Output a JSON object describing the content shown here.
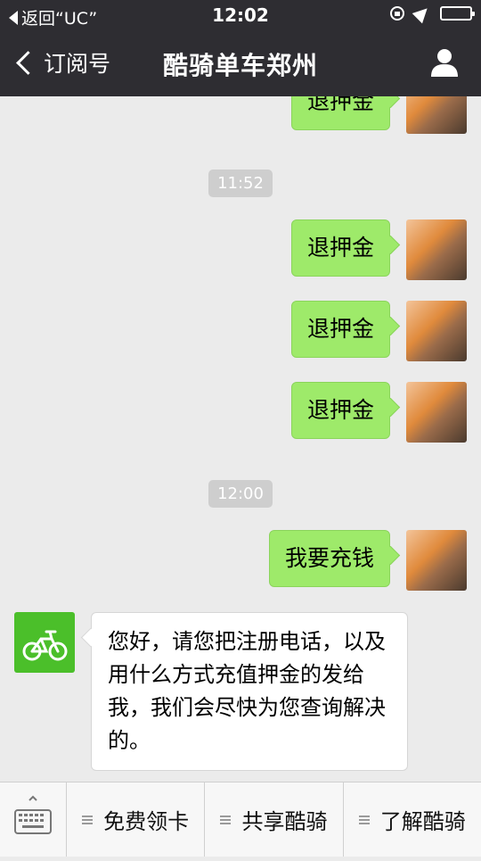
{
  "status": {
    "back_app": "返回“UC”",
    "time": "12:02"
  },
  "nav": {
    "back_label": "订阅号",
    "title": "酷骑单车郑州"
  },
  "messages": {
    "m0": "退押金",
    "t1": "11:52",
    "m1": "退押金",
    "m2": "退押金",
    "m3": "退押金",
    "t2": "12:00",
    "m4": "我要充钱",
    "bot": "您好，请您把注册电话，以及用什么方式充值押金的发给我，我们会尽快为您查询解决的。"
  },
  "bottom": {
    "menu1": "免费领卡",
    "menu2": "共享酷骑",
    "menu3": "了解酷骑"
  },
  "colors": {
    "topbar": "#2e2d32",
    "bubble_out": "#9eea6a",
    "bot_avatar": "#4bbf2a",
    "chat_bg": "#ebebeb"
  }
}
